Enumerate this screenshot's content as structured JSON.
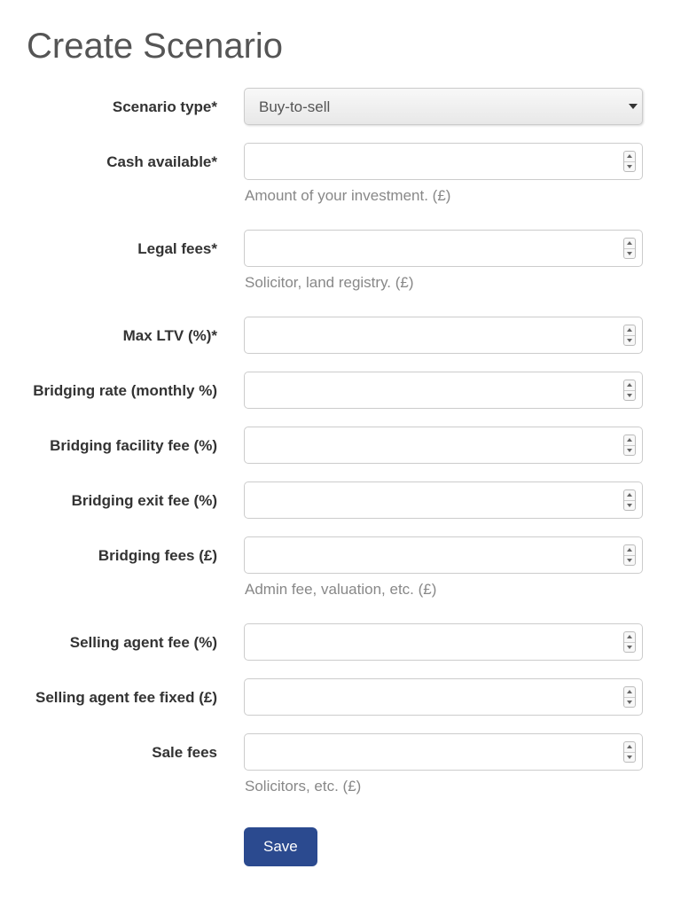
{
  "page": {
    "title": "Create Scenario"
  },
  "fields": {
    "scenario_type": {
      "label": "Scenario type*",
      "selected": "Buy-to-sell"
    },
    "cash_available": {
      "label": "Cash available*",
      "value": "",
      "help": "Amount of your investment. (£)"
    },
    "legal_fees": {
      "label": "Legal fees*",
      "value": "",
      "help": "Solicitor, land registry. (£)"
    },
    "max_ltv": {
      "label": "Max LTV (%)*",
      "value": ""
    },
    "bridging_rate": {
      "label": "Bridging rate (monthly %)",
      "value": ""
    },
    "bridging_facility_fee": {
      "label": "Bridging facility fee (%)",
      "value": ""
    },
    "bridging_exit_fee": {
      "label": "Bridging exit fee (%)",
      "value": ""
    },
    "bridging_fees": {
      "label": "Bridging fees (£)",
      "value": "",
      "help": "Admin fee, valuation, etc. (£)"
    },
    "selling_agent_fee_pct": {
      "label": "Selling agent fee (%)",
      "value": ""
    },
    "selling_agent_fee_fixed": {
      "label": "Selling agent fee fixed (£)",
      "value": ""
    },
    "sale_fees": {
      "label": "Sale fees",
      "value": "",
      "help": "Solicitors, etc. (£)"
    }
  },
  "buttons": {
    "save": "Save"
  }
}
